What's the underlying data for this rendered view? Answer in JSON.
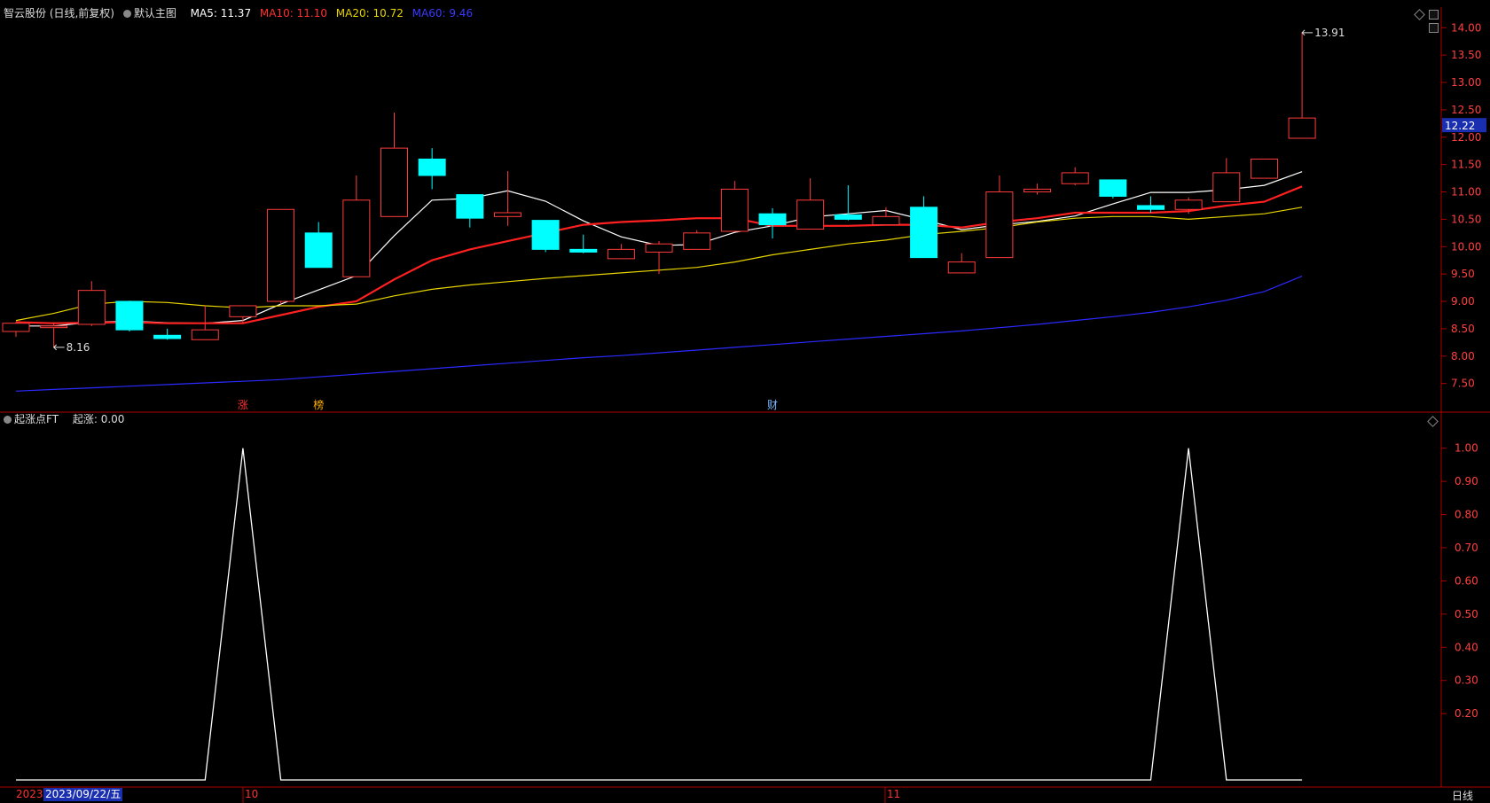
{
  "header": {
    "stock": "智云股份 (日线,前复权)",
    "template": "默认主图",
    "ma5": "MA5: 11.37",
    "ma10": "MA10: 11.10",
    "ma20": "MA20: 10.72",
    "ma60": "MA60: 9.46"
  },
  "indicator": {
    "name": "起涨点FT",
    "value": "起涨: 0.00"
  },
  "footer": {
    "year": "2023",
    "cursor_date": "2023/09/22/五",
    "month_oct": "10",
    "month_nov": "11",
    "timeframe": "日线"
  },
  "colors": {
    "up": "#ff3b3b",
    "down": "#00ffff",
    "ma5": "#ffffff",
    "ma10": "#ff2020",
    "ma20": "#e6d400",
    "ma60": "#2a2aff",
    "axis": "#b00000",
    "cursor_label_bg": "#1a2fb0"
  },
  "chart_data": [
    {
      "type": "candlestick",
      "title": "智云股份 (日线,前复权)",
      "ylim": [
        7.3,
        14.15
      ],
      "y_ticks": [
        "14.00",
        "13.50",
        "13.00",
        "12.50",
        "12.00",
        "11.50",
        "11.00",
        "10.50",
        "10.00",
        "9.50",
        "9.00",
        "8.50",
        "8.00",
        "7.50"
      ],
      "current_price": "12.22",
      "annotations": [
        {
          "text": "13.91",
          "type": "high"
        },
        {
          "text": "8.16",
          "type": "low"
        }
      ],
      "markers": [
        "涨",
        "榜",
        "财"
      ],
      "candles": [
        {
          "o": 8.45,
          "h": 8.62,
          "l": 8.35,
          "c": 8.6
        },
        {
          "o": 8.52,
          "h": 8.62,
          "l": 8.16,
          "c": 8.55
        },
        {
          "o": 8.58,
          "h": 9.37,
          "l": 8.55,
          "c": 9.2
        },
        {
          "o": 9.0,
          "h": 9.0,
          "l": 8.45,
          "c": 8.48
        },
        {
          "o": 8.38,
          "h": 8.5,
          "l": 8.3,
          "c": 8.32
        },
        {
          "o": 8.3,
          "h": 8.92,
          "l": 8.3,
          "c": 8.48
        },
        {
          "o": 8.72,
          "h": 8.92,
          "l": 8.6,
          "c": 8.92
        },
        {
          "o": 9.0,
          "h": 10.68,
          "l": 8.95,
          "c": 10.68
        },
        {
          "o": 10.25,
          "h": 10.45,
          "l": 9.65,
          "c": 9.62
        },
        {
          "o": 9.45,
          "h": 11.3,
          "l": 9.45,
          "c": 10.85
        },
        {
          "o": 10.55,
          "h": 12.45,
          "l": 10.55,
          "c": 11.8
        },
        {
          "o": 11.6,
          "h": 11.8,
          "l": 11.05,
          "c": 11.3
        },
        {
          "o": 10.95,
          "h": 10.95,
          "l": 10.35,
          "c": 10.52
        },
        {
          "o": 10.55,
          "h": 11.38,
          "l": 10.38,
          "c": 10.62
        },
        {
          "o": 10.48,
          "h": 10.48,
          "l": 9.9,
          "c": 9.95
        },
        {
          "o": 9.95,
          "h": 10.22,
          "l": 9.88,
          "c": 9.9
        },
        {
          "o": 9.78,
          "h": 10.05,
          "l": 9.78,
          "c": 9.95
        },
        {
          "o": 9.9,
          "h": 10.1,
          "l": 9.5,
          "c": 10.05
        },
        {
          "o": 9.95,
          "h": 10.3,
          "l": 9.95,
          "c": 10.25
        },
        {
          "o": 10.28,
          "h": 11.2,
          "l": 10.28,
          "c": 11.05
        },
        {
          "o": 10.6,
          "h": 10.7,
          "l": 10.15,
          "c": 10.4
        },
        {
          "o": 10.32,
          "h": 11.25,
          "l": 10.32,
          "c": 10.85
        },
        {
          "o": 10.58,
          "h": 11.12,
          "l": 10.48,
          "c": 10.5
        },
        {
          "o": 10.4,
          "h": 10.72,
          "l": 10.4,
          "c": 10.55
        },
        {
          "o": 10.72,
          "h": 10.92,
          "l": 10.25,
          "c": 9.8
        },
        {
          "o": 9.52,
          "h": 9.88,
          "l": 9.52,
          "c": 9.72
        },
        {
          "o": 9.8,
          "h": 11.3,
          "l": 9.8,
          "c": 11.0
        },
        {
          "o": 11.0,
          "h": 11.15,
          "l": 10.95,
          "c": 11.05
        },
        {
          "o": 11.15,
          "h": 11.45,
          "l": 11.12,
          "c": 11.35
        },
        {
          "o": 11.22,
          "h": 11.22,
          "l": 10.88,
          "c": 10.92
        },
        {
          "o": 10.75,
          "h": 10.92,
          "l": 10.62,
          "c": 10.68
        },
        {
          "o": 10.68,
          "h": 10.9,
          "l": 10.6,
          "c": 10.85
        },
        {
          "o": 10.82,
          "h": 11.62,
          "l": 10.82,
          "c": 11.35
        },
        {
          "o": 11.25,
          "h": 11.6,
          "l": 11.25,
          "c": 11.6
        },
        {
          "o": 11.98,
          "h": 13.91,
          "l": 11.98,
          "c": 12.35
        }
      ],
      "series": [
        {
          "name": "MA5",
          "values": [
            8.55,
            8.55,
            8.62,
            8.64,
            8.61,
            8.6,
            8.65,
            8.95,
            9.21,
            9.47,
            10.2,
            10.85,
            10.88,
            11.02,
            10.83,
            10.47,
            10.18,
            10.02,
            10.04,
            10.26,
            10.38,
            10.54,
            10.6,
            10.66,
            10.49,
            10.31,
            10.4,
            10.46,
            10.56,
            10.78,
            10.99,
            10.99,
            11.04,
            11.12,
            11.37
          ]
        },
        {
          "name": "MA10",
          "values": [
            8.62,
            8.6,
            8.61,
            8.62,
            8.6,
            8.6,
            8.6,
            8.75,
            8.9,
            9.0,
            9.4,
            9.75,
            9.95,
            10.1,
            10.25,
            10.4,
            10.45,
            10.48,
            10.52,
            10.52,
            10.38,
            10.38,
            10.38,
            10.4,
            10.4,
            10.35,
            10.45,
            10.52,
            10.62,
            10.62,
            10.62,
            10.65,
            10.75,
            10.82,
            11.1
          ]
        },
        {
          "name": "MA20",
          "values": [
            8.65,
            8.78,
            8.95,
            9.0,
            8.98,
            8.92,
            8.88,
            8.92,
            8.92,
            8.95,
            9.1,
            9.22,
            9.3,
            9.36,
            9.42,
            9.47,
            9.52,
            9.57,
            9.62,
            9.72,
            9.85,
            9.95,
            10.05,
            10.12,
            10.22,
            10.28,
            10.35,
            10.45,
            10.52,
            10.55,
            10.55,
            10.5,
            10.55,
            10.6,
            10.72
          ]
        },
        {
          "name": "MA60",
          "values": [
            7.36,
            7.39,
            7.42,
            7.45,
            7.48,
            7.51,
            7.54,
            7.57,
            7.62,
            7.67,
            7.72,
            7.77,
            7.82,
            7.87,
            7.92,
            7.97,
            8.01,
            8.06,
            8.11,
            8.16,
            8.21,
            8.26,
            8.31,
            8.36,
            8.41,
            8.46,
            8.52,
            8.58,
            8.65,
            8.72,
            8.8,
            8.9,
            9.02,
            9.18,
            9.46
          ]
        }
      ]
    },
    {
      "type": "line",
      "title": "起涨点FT",
      "ylim": [
        0,
        1.05
      ],
      "y_ticks": [
        "1.00",
        "0.90",
        "0.80",
        "0.70",
        "0.60",
        "0.50",
        "0.40",
        "0.30",
        "0.20"
      ],
      "series": [
        {
          "name": "起涨",
          "values": [
            0,
            0,
            0,
            0,
            0,
            0,
            1,
            0,
            0,
            0,
            0,
            0,
            0,
            0,
            0,
            0,
            0,
            0,
            0,
            0,
            0,
            0,
            0,
            0,
            0,
            0,
            0,
            0,
            0,
            0,
            0,
            1,
            0,
            0,
            0
          ]
        }
      ]
    }
  ]
}
